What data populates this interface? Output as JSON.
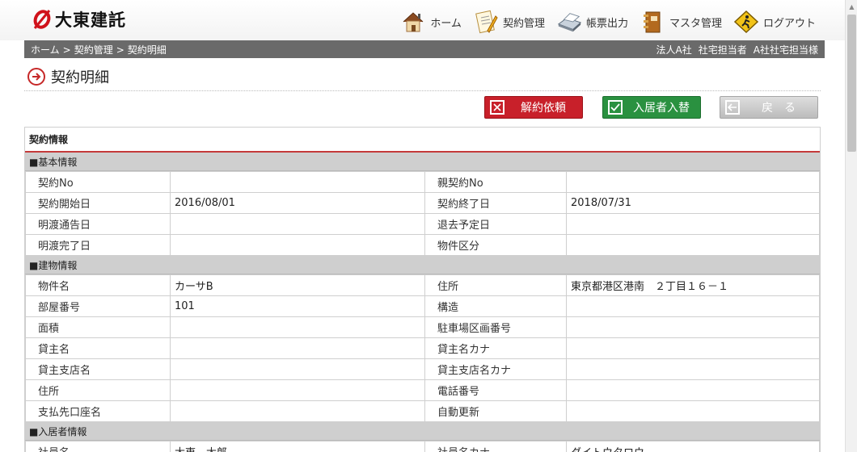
{
  "header": {
    "logo_text": "大東建託",
    "nav": [
      {
        "label": "ホーム",
        "icon": "home-icon"
      },
      {
        "label": "契約管理",
        "icon": "contract-icon"
      },
      {
        "label": "帳票出力",
        "icon": "printer-icon"
      },
      {
        "label": "マスタ管理",
        "icon": "binder-icon"
      },
      {
        "label": "ログアウト",
        "icon": "logout-icon"
      }
    ]
  },
  "breadcrumb": {
    "items": [
      "ホーム",
      "契約管理",
      "契約明細"
    ],
    "separator": ">",
    "user": [
      "法人A社",
      "社宅担当者",
      "A社社宅担当様"
    ]
  },
  "page": {
    "title": "契約明細"
  },
  "actions": {
    "cancel_label": "解約依頼",
    "swap_label": "入居者入替",
    "back_label": "戻る"
  },
  "panel": {
    "title": "契約情報",
    "sections": {
      "basic": {
        "title": "■基本情報",
        "rows": [
          [
            "契約No",
            "",
            "親契約No",
            ""
          ],
          [
            "契約開始日",
            "2016/08/01",
            "契約終了日",
            "2018/07/31"
          ],
          [
            "明渡通告日",
            "",
            "退去予定日",
            ""
          ],
          [
            "明渡完了日",
            "",
            "物件区分",
            ""
          ]
        ]
      },
      "building": {
        "title": "■建物情報",
        "rows": [
          [
            "物件名",
            "カーサB",
            "住所",
            "東京都港区港南　２丁目１６－１"
          ],
          [
            "部屋番号",
            "101",
            "構造",
            ""
          ],
          [
            "面積",
            "",
            "駐車場区画番号",
            ""
          ],
          [
            "貸主名",
            "",
            "貸主名カナ",
            ""
          ],
          [
            "貸主支店名",
            "",
            "貸主支店名カナ",
            ""
          ],
          [
            "住所",
            "",
            "電話番号",
            ""
          ],
          [
            "支払先口座名",
            "",
            "自動更新",
            ""
          ]
        ]
      },
      "resident": {
        "title": "■入居者情報",
        "rows": [
          [
            "社員名",
            "大東　太郎",
            "社員名カナ",
            "ダイトウタロウ"
          ]
        ]
      }
    }
  },
  "colors": {
    "brand_red": "#c8202a",
    "green": "#2a9140",
    "breadcrumb_bg": "#6a6a6a",
    "section_bg": "#cfcfcf"
  }
}
